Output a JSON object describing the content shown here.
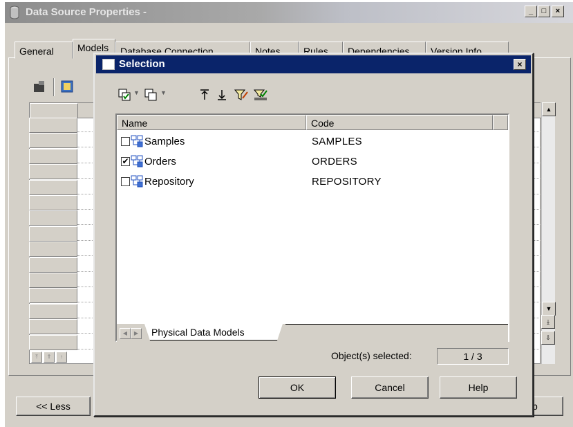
{
  "main_window": {
    "title": "Data Source Properties -",
    "buttons": [
      "_",
      "□",
      "×"
    ],
    "tabs": [
      "General",
      "Models",
      "Database Connection",
      "Notes",
      "Rules",
      "Dependencies",
      "Version Info"
    ],
    "less_button": "<< Less",
    "help_button_fragment": "p"
  },
  "selection_dialog": {
    "title": "Selection",
    "close": "×",
    "columns": [
      "Name",
      "Code"
    ],
    "rows": [
      {
        "name": "Samples",
        "code": "SAMPLES",
        "checked": false
      },
      {
        "name": "Orders",
        "code": "ORDERS",
        "checked": true
      },
      {
        "name": "Repository",
        "code": "REPOSITORY",
        "checked": false
      }
    ],
    "tab_label": "Physical Data Models",
    "count_label": "Object(s) selected:",
    "count_value": "1 / 3",
    "ok": "OK",
    "cancel": "Cancel",
    "help": "Help",
    "check_mark": "✔"
  },
  "colors": {
    "dialog_titlebar": "#0a246a",
    "face": "#d4d0c8"
  }
}
